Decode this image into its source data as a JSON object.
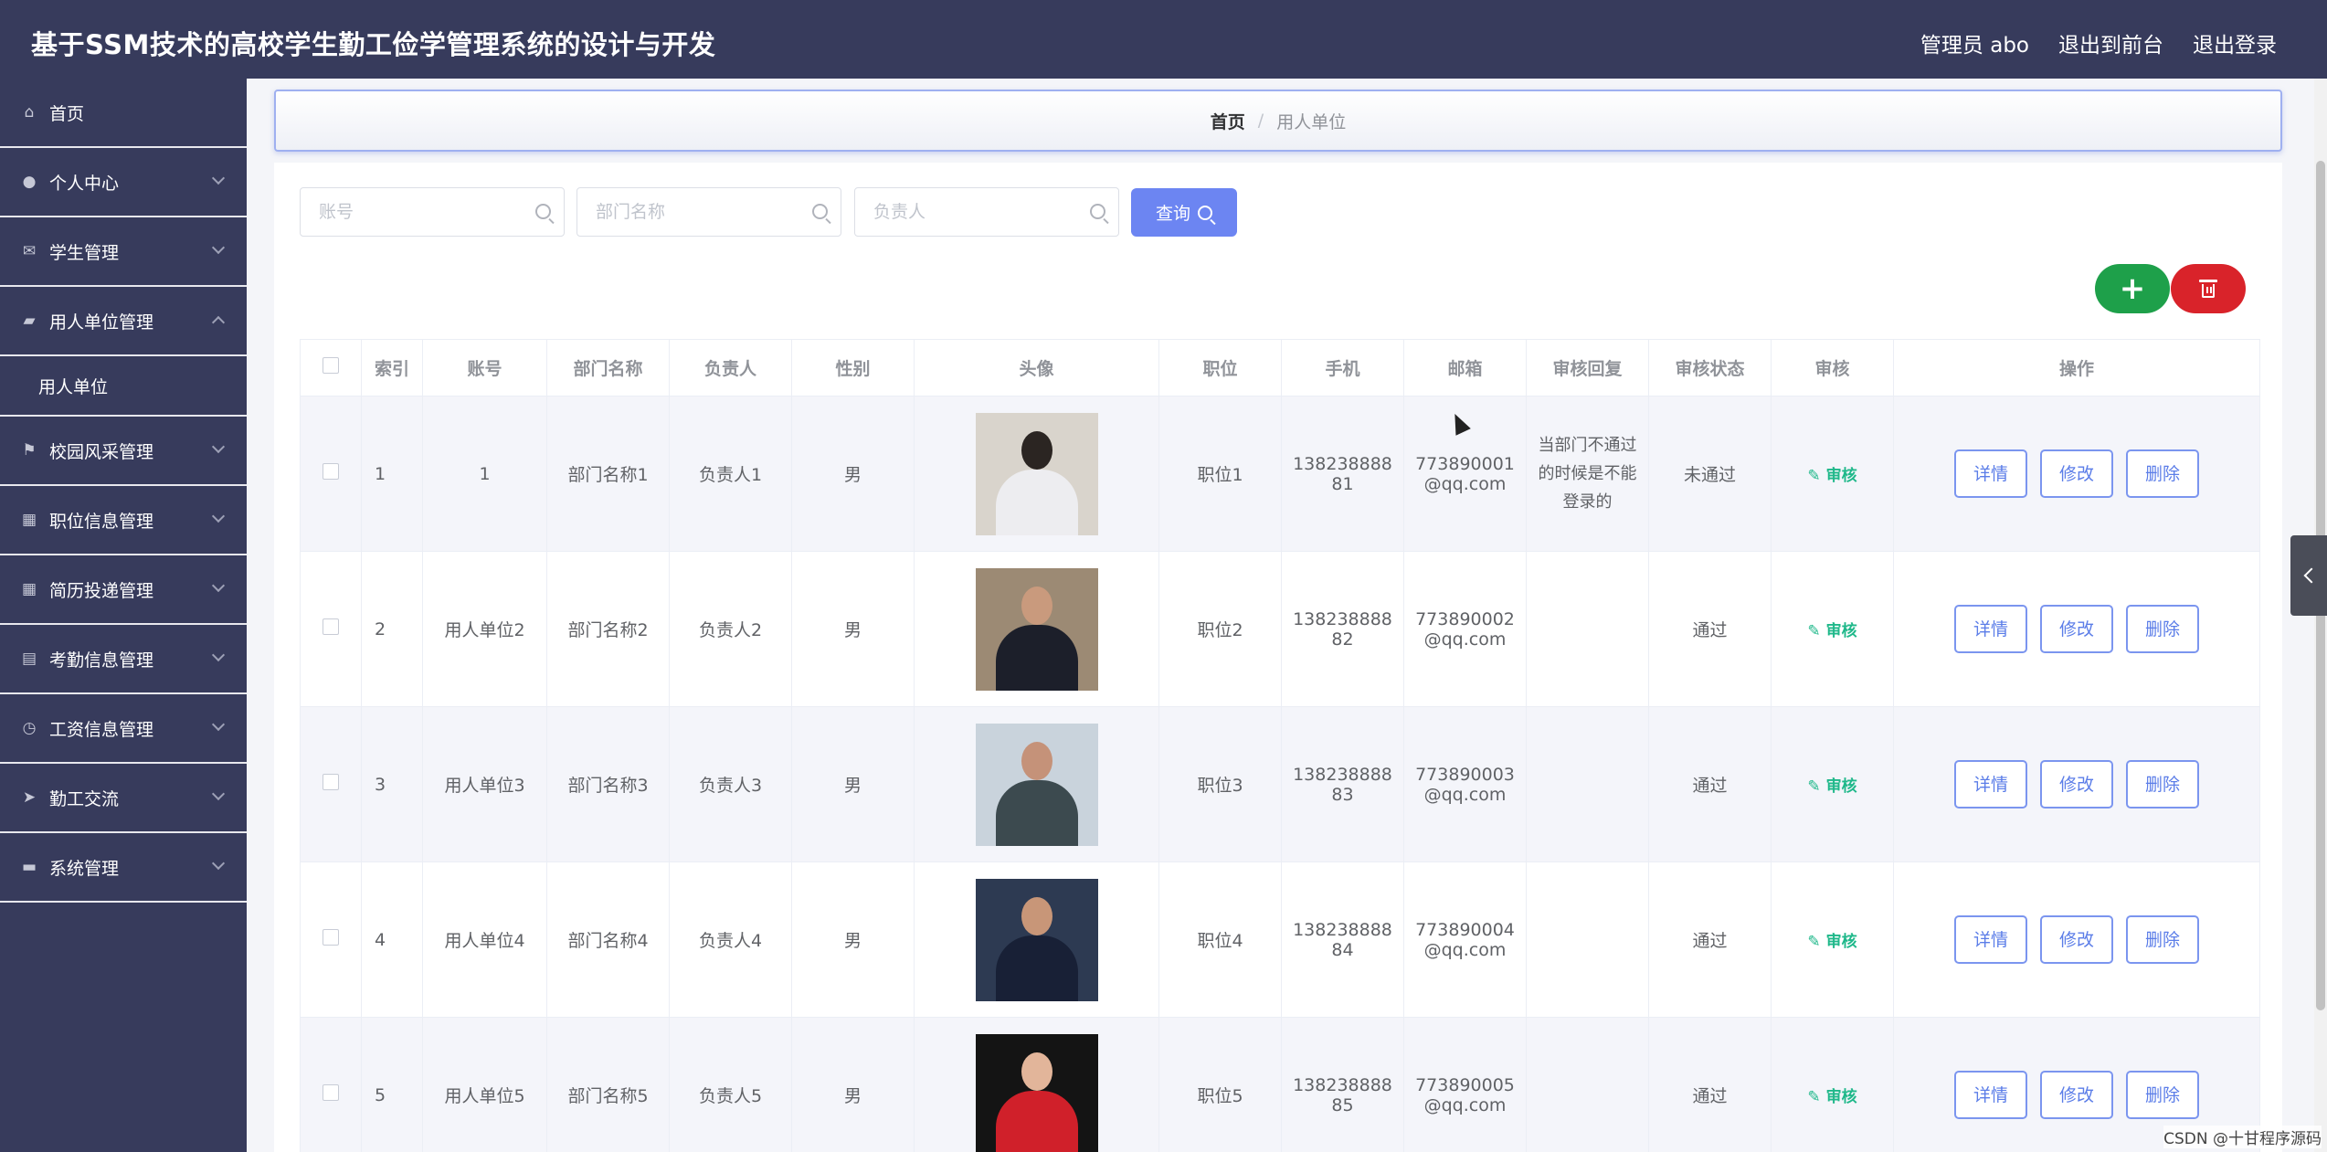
{
  "app": {
    "title": "基于SSM技术的高校学生勤工俭学管理系统的设计与开发",
    "user_label": "管理员 abo",
    "back_front": "退出到前台",
    "logout": "退出登录"
  },
  "sidebar": {
    "items": [
      {
        "label": "首页",
        "icon": "home-icon",
        "glyph": "⌂",
        "expandable": false
      },
      {
        "label": "个人中心",
        "icon": "user-icon",
        "glyph": "●",
        "expandable": true
      },
      {
        "label": "学生管理",
        "icon": "mail-icon",
        "glyph": "✉",
        "expandable": true
      },
      {
        "label": "用人单位管理",
        "icon": "briefcase-icon",
        "glyph": "▰",
        "expandable": true,
        "open": true
      },
      {
        "label": "校园风采管理",
        "icon": "flag-icon",
        "glyph": "⚑",
        "expandable": true
      },
      {
        "label": "职位信息管理",
        "icon": "grid-icon",
        "glyph": "▦",
        "expandable": true
      },
      {
        "label": "简历投递管理",
        "icon": "apps-icon",
        "glyph": "▦",
        "expandable": true
      },
      {
        "label": "考勤信息管理",
        "icon": "chart-icon",
        "glyph": "▤",
        "expandable": true
      },
      {
        "label": "工资信息管理",
        "icon": "clock-icon",
        "glyph": "◷",
        "expandable": true
      },
      {
        "label": "勤工交流",
        "icon": "send-icon",
        "glyph": "➤",
        "expandable": true
      },
      {
        "label": "系统管理",
        "icon": "chat-icon",
        "glyph": "▬",
        "expandable": true
      }
    ],
    "submenu": "用人单位"
  },
  "breadcrumb": {
    "home": "首页",
    "separator": "/",
    "current": "用人单位"
  },
  "search": {
    "account_placeholder": "账号",
    "dept_placeholder": "部门名称",
    "owner_placeholder": "负责人",
    "query_label": "查询"
  },
  "toolbar": {
    "add_label": "+"
  },
  "table": {
    "headers": [
      "索引",
      "账号",
      "部门名称",
      "负责人",
      "性别",
      "头像",
      "职位",
      "手机",
      "邮箱",
      "审核回复",
      "审核状态",
      "审核",
      "操作"
    ],
    "audit_label": "审核",
    "actions": [
      "详情",
      "修改",
      "删除"
    ],
    "rows": [
      {
        "index": "1",
        "account": "1",
        "dept": "部门名称1",
        "owner": "负责人1",
        "gender": "男",
        "position": "职位1",
        "phone_a": "138238888",
        "phone_b": "81",
        "email_a": "773890001",
        "email_b": "@qq.com",
        "reply": "当部门不通过的时候是不能登录的",
        "status": "未通过",
        "avatar_bg": "#d9d4cc",
        "avatar_body": "#ededf0",
        "avatar_head": "#2b2522"
      },
      {
        "index": "2",
        "account": "用人单位2",
        "dept": "部门名称2",
        "owner": "负责人2",
        "gender": "男",
        "position": "职位2",
        "phone_a": "138238888",
        "phone_b": "82",
        "email_a": "773890002",
        "email_b": "@qq.com",
        "reply": "",
        "status": "通过",
        "avatar_bg": "#9c8a74",
        "avatar_body": "#1c1f2a",
        "avatar_head": "#c99a7d"
      },
      {
        "index": "3",
        "account": "用人单位3",
        "dept": "部门名称3",
        "owner": "负责人3",
        "gender": "男",
        "position": "职位3",
        "phone_a": "138238888",
        "phone_b": "83",
        "email_a": "773890003",
        "email_b": "@qq.com",
        "reply": "",
        "status": "通过",
        "avatar_bg": "#c9d3dc",
        "avatar_body": "#3c4a4f",
        "avatar_head": "#c59279"
      },
      {
        "index": "4",
        "account": "用人单位4",
        "dept": "部门名称4",
        "owner": "负责人4",
        "gender": "男",
        "position": "职位4",
        "phone_a": "138238888",
        "phone_b": "84",
        "email_a": "773890004",
        "email_b": "@qq.com",
        "reply": "",
        "status": "通过",
        "avatar_bg": "#2d3a52",
        "avatar_body": "#182036",
        "avatar_head": "#c89678"
      },
      {
        "index": "5",
        "account": "用人单位5",
        "dept": "部门名称5",
        "owner": "负责人5",
        "gender": "男",
        "position": "职位5",
        "phone_a": "138238888",
        "phone_b": "85",
        "email_a": "773890005",
        "email_b": "@qq.com",
        "reply": "",
        "status": "通过",
        "avatar_bg": "#141414",
        "avatar_body": "#d0202a",
        "avatar_head": "#e2b59a"
      }
    ]
  },
  "watermark": "CSDN @十甘程序源码",
  "colors": {
    "header_bg": "#373b5c",
    "primary": "#6c85f2",
    "add": "#1ea04a",
    "delete": "#d9232a",
    "audit": "#1fb88a"
  }
}
